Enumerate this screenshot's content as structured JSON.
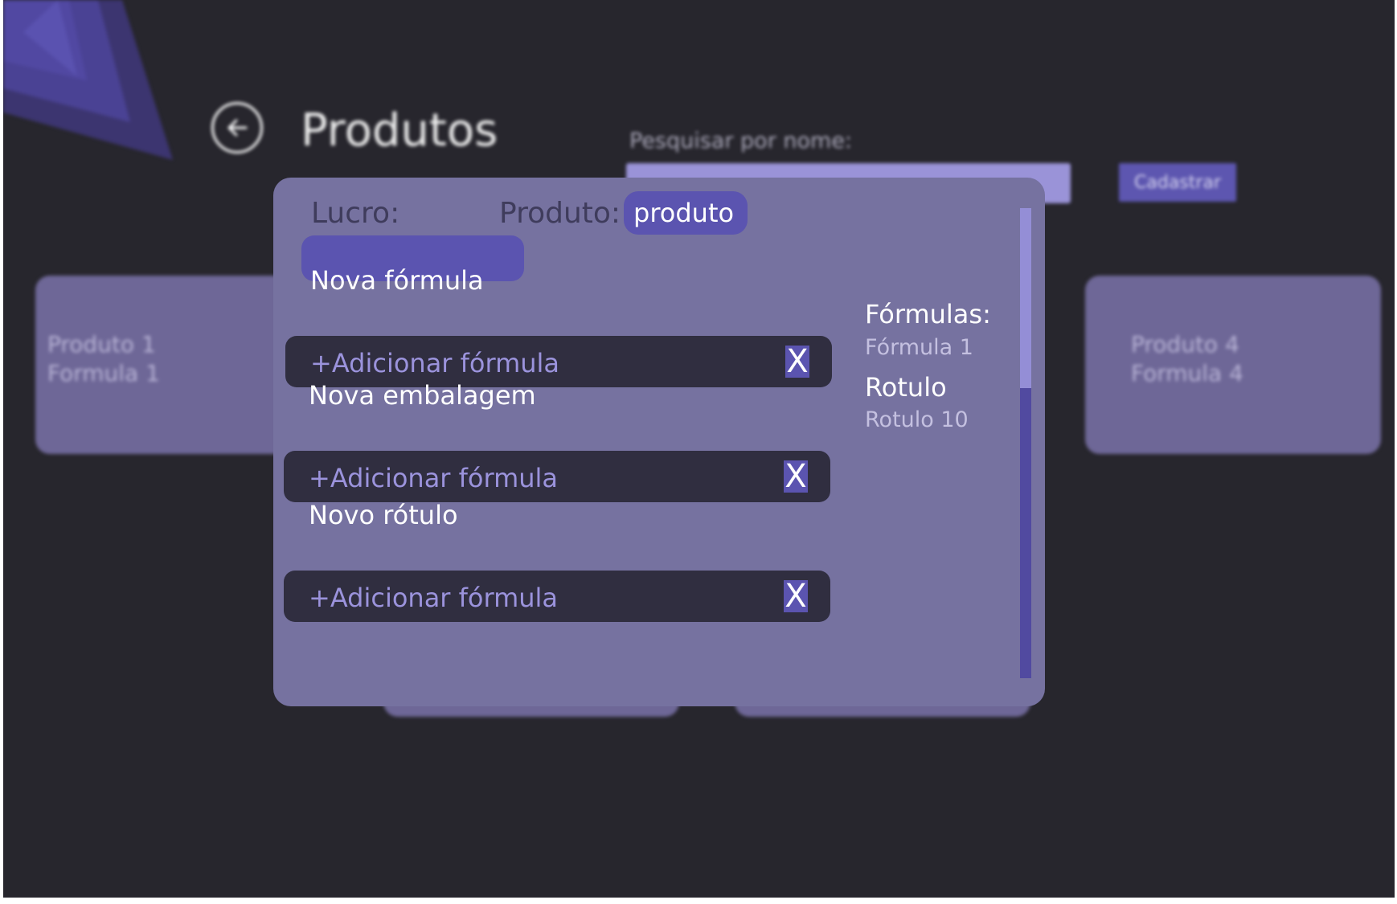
{
  "header": {
    "title": "Produtos",
    "search_label": "Pesquisar por nome:",
    "search_value": "",
    "register_label": "Cadastrar"
  },
  "cards": [
    {
      "line1": "Produto 1",
      "line2": "Formula 1"
    },
    {
      "line1": "Produto 4",
      "line2": "Formula 4"
    }
  ],
  "modal": {
    "lucro_label": "Lucro:",
    "lucro_value": "",
    "produto_label": "Produto:",
    "produto_value": "produto",
    "sections": [
      {
        "label": "Nova fórmula",
        "add_text": "+Adicionar fórmula",
        "remove_label": "X"
      },
      {
        "label": "Nova embalagem",
        "add_text": "+Adicionar fórmula",
        "remove_label": "X"
      },
      {
        "label": "Novo rótulo",
        "add_text": "+Adicionar fórmula",
        "remove_label": "X"
      }
    ],
    "sidebar": {
      "formulas_title": "Fórmulas:",
      "formulas_item": "Fórmula 1",
      "rotulo_title": "Rotulo",
      "rotulo_item": "Rotulo 10"
    },
    "scroll": {
      "thumb_fraction": 0.38
    }
  },
  "icons": {
    "back": "arrow-left-icon"
  },
  "colors": {
    "background": "#27262d",
    "modal": "#7672a0",
    "accent": "#5b54b0",
    "card": "#6e6797",
    "field": "#302e40",
    "search": "#9a93d8"
  }
}
